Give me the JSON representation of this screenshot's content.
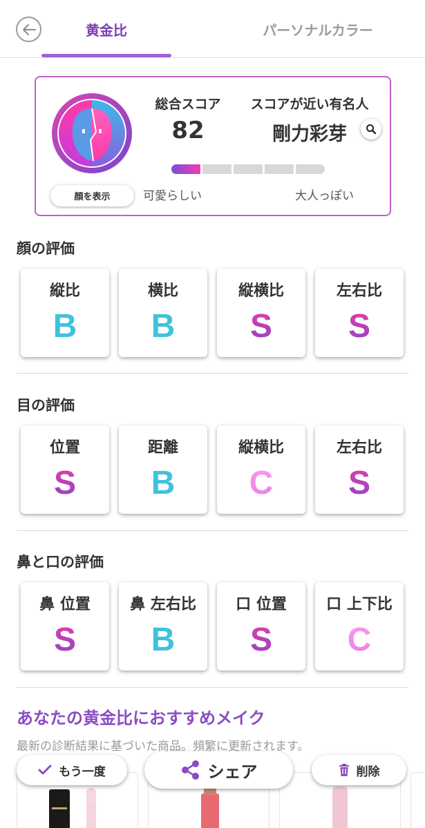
{
  "header": {
    "tabs": [
      {
        "label": "黄金比",
        "active": true
      },
      {
        "label": "パーソナルカラー",
        "active": false
      }
    ]
  },
  "score_card": {
    "face_button_label": "顔を表示",
    "total_score_label": "総合スコア",
    "total_score": "82",
    "celebrity_label": "スコアが近い有名人",
    "celebrity_name": "剛力彩芽",
    "scale_left_label": "可愛らしい",
    "scale_right_label": "大人っぽい",
    "scale_level": 1,
    "scale_segments": 5
  },
  "sections": [
    {
      "title": "顔の評価",
      "items": [
        {
          "label": "縦比",
          "grade": "B"
        },
        {
          "label": "横比",
          "grade": "B"
        },
        {
          "label": "縦横比",
          "grade": "S"
        },
        {
          "label": "左右比",
          "grade": "S"
        }
      ]
    },
    {
      "title": "目の評価",
      "items": [
        {
          "label": "位置",
          "grade": "S"
        },
        {
          "label": "距離",
          "grade": "B"
        },
        {
          "label": "縦横比",
          "grade": "C"
        },
        {
          "label": "左右比",
          "grade": "S"
        }
      ]
    },
    {
      "title": "鼻と口の評価",
      "items": [
        {
          "label": "鼻 位置",
          "grade": "S"
        },
        {
          "label": "鼻 左右比",
          "grade": "B"
        },
        {
          "label": "口 位置",
          "grade": "S"
        },
        {
          "label": "口 上下比",
          "grade": "C"
        }
      ]
    }
  ],
  "recommendation": {
    "title": "あなたの黄金比におすすめメイク",
    "subtitle": "最新の診断結果に基づいた商品。頻繁に更新されます。"
  },
  "actions": {
    "retry_label": "もう一度",
    "share_label": "シェア",
    "delete_label": "削除"
  },
  "colors": {
    "accent": "#8a4cc3",
    "grade_S": "#b23fb8",
    "grade_B": "#3fc3dc",
    "grade_C": "#f28fe6"
  }
}
